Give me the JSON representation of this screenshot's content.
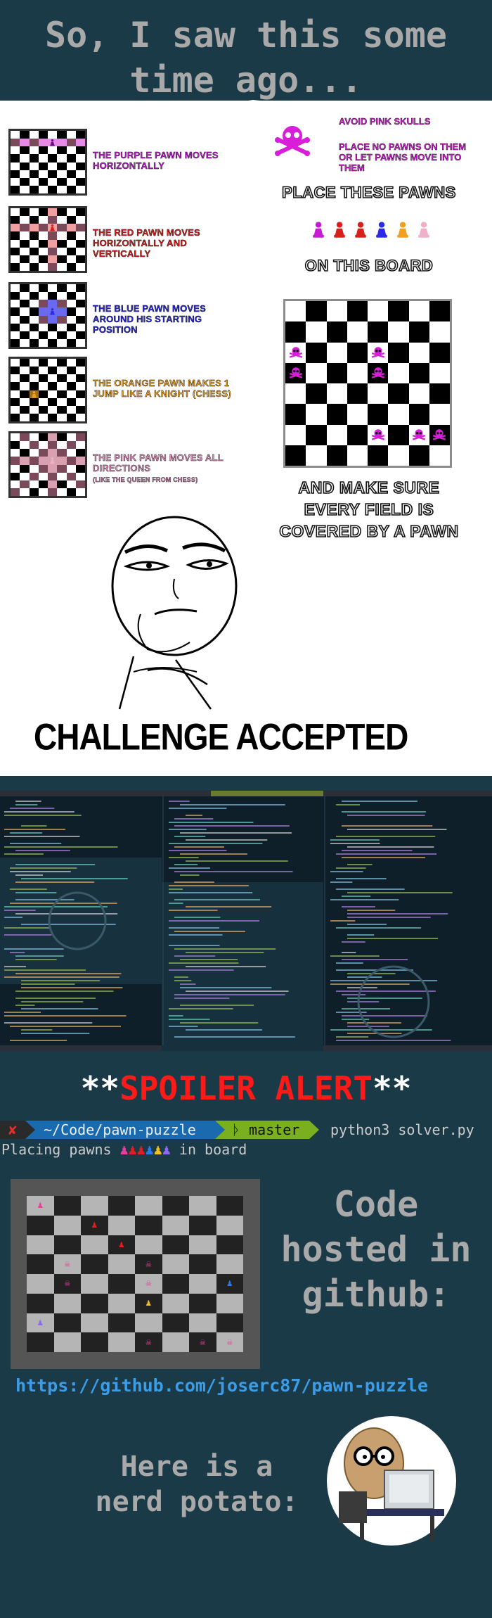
{
  "title": "So, I saw this some time ago...",
  "legend": [
    {
      "text": "THE PURPLE PAWN MOVES HORIZONTALLY",
      "sub": "",
      "color": "#c81bd8",
      "pawn": "#6b0f8a",
      "hl": "#e68ae6"
    },
    {
      "text": "THE RED PAWN MOVES HORIZONTALLY AND VERTICALLY",
      "sub": "",
      "color": "#e0201a",
      "pawn": "#d8201a",
      "hl": "#f0a0a0"
    },
    {
      "text": "THE BLUE PAWN MOVES AROUND HIS STARTING POSITION",
      "sub": "",
      "color": "#2a2ae8",
      "pawn": "#2a2ae8",
      "hl": "#6a6af0"
    },
    {
      "text": "THE ORANGE PAWN MAKES 1 JUMP LIKE A KNIGHT (CHESS)",
      "sub": "",
      "color": "#f0a020",
      "pawn": "#f0a020",
      "hl": "#a07020"
    },
    {
      "text": "THE PINK PAWN MOVES ALL DIRECTIONS",
      "sub": "(LIKE THE QUEEN FROM CHESS)",
      "color": "#e890c0",
      "pawn": "#f0b0c8",
      "hl": "#d8a0b0"
    }
  ],
  "rules": {
    "avoid": "AVOID PINK SKULLS",
    "place_no": "PLACE NO PAWNS ON THEM OR LET PAWNS MOVE INTO THEM",
    "place_these": "PLACE THESE PAWNS",
    "on_board": "ON THIS BOARD",
    "make_sure": "AND MAKE SURE EVERY FIELD IS COVERED BY A PAWN"
  },
  "pawn_colors": [
    "#c81bd8",
    "#d8201a",
    "#d8201a",
    "#2a2ae8",
    "#f0a020",
    "#f0b0c8"
  ],
  "challenge": "CHALLENGE ACCEPTED",
  "spoiler": {
    "pre": "**",
    "word": "SPOILER ALERT",
    "post": "**"
  },
  "prompt": {
    "x": "✘",
    "path": "~/Code/pawn-puzzle",
    "branch": "ᚦ master",
    "cmd": "python3 solver.py"
  },
  "placing": {
    "before": "Placing pawns",
    "after": "in board"
  },
  "placing_pawns": [
    "#e8409a",
    "#e02020",
    "#e02020",
    "#2a7ae8",
    "#f0c020",
    "#8a6af0"
  ],
  "code_hosted": "Code hosted in github:",
  "github": "https://github.com/joserc87/pawn-puzzle",
  "potato": "Here is a nerd potato:"
}
